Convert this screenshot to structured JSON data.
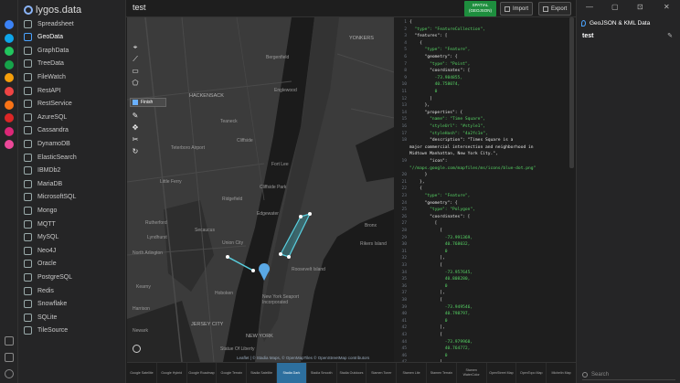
{
  "rail": {
    "icons": [
      {
        "name": "spreadsheet-rail-icon",
        "color": "#3b82f6"
      },
      {
        "name": "geodata-rail-icon",
        "color": "#0ea5e9"
      },
      {
        "name": "graphdata-rail-icon",
        "color": "#22c55e"
      },
      {
        "name": "treedata-rail-icon",
        "color": "#16a34a"
      },
      {
        "name": "filewatch-rail-icon",
        "color": "#f59e0b"
      },
      {
        "name": "restapi-rail-icon",
        "color": "#ef4444"
      },
      {
        "name": "restservice-rail-icon",
        "color": "#f97316"
      },
      {
        "name": "azuresql-rail-icon",
        "color": "#dc2626"
      },
      {
        "name": "cassandra-rail-icon",
        "color": "#db2777"
      },
      {
        "name": "dynamodb-rail-icon",
        "color": "#ec4899"
      }
    ]
  },
  "sidebar": {
    "brand": "lygos.data",
    "items": [
      {
        "label": "Spreadsheet",
        "icon": "grid-icon"
      },
      {
        "label": "GeoData",
        "icon": "globe-icon"
      },
      {
        "label": "GraphData",
        "icon": "graph-icon"
      },
      {
        "label": "TreeData",
        "icon": "tree-icon"
      },
      {
        "label": "FileWatch",
        "icon": "file-icon"
      },
      {
        "label": "RestAPI",
        "icon": "api-icon"
      },
      {
        "label": "RestService",
        "icon": "service-icon"
      },
      {
        "label": "AzureSQL",
        "icon": "database-icon"
      },
      {
        "label": "Cassandra",
        "icon": "database-icon"
      },
      {
        "label": "DynamoDB",
        "icon": "database-icon"
      },
      {
        "label": "ElasticSearch",
        "icon": "search-icon"
      },
      {
        "label": "IBMDb2",
        "icon": "database-icon"
      },
      {
        "label": "MariaDB",
        "icon": "database-icon"
      },
      {
        "label": "MicrosoftSQL",
        "icon": "database-icon"
      },
      {
        "label": "Mongo",
        "icon": "database-icon"
      },
      {
        "label": "MQTT",
        "icon": "broadcast-icon"
      },
      {
        "label": "MySQL",
        "icon": "database-icon"
      },
      {
        "label": "Neo4J",
        "icon": "graph-icon"
      },
      {
        "label": "Oracle",
        "icon": "database-icon"
      },
      {
        "label": "PostgreSQL",
        "icon": "database-icon"
      },
      {
        "label": "Redis",
        "icon": "database-icon"
      },
      {
        "label": "Snowflake",
        "icon": "snowflake-icon"
      },
      {
        "label": "SQLite",
        "icon": "database-icon"
      },
      {
        "label": "TileSource",
        "icon": "tiles-icon"
      }
    ],
    "active_index": 1
  },
  "topbar": {
    "title": "test",
    "badge": "SPATIAL (GEOJSON)",
    "import_label": "Import",
    "export_label": "Export"
  },
  "map": {
    "labels": {
      "yonkers": "YONKERS",
      "hackensack": "HACKENSACK",
      "englewood": "Englewood",
      "teaneck": "Teaneck",
      "bergenfield": "Bergenfield",
      "fort_lee": "Fort Lee",
      "cliffside_park": "Cliffside Park",
      "teterboro": "Teterboro Airport",
      "little_ferry": "Little Ferry",
      "ridgefield": "Ridgefield",
      "union_city": "Union City",
      "hoboken": "Hoboken",
      "jersey_city": "JERSEY CITY",
      "new_york": "NEW YORK",
      "ny_seaport": "New York Seaport Incorporated",
      "roosevelt_island": "Roosevelt Island",
      "bronx": "Bronx",
      "rikers": "Rikers Island",
      "north_arlington": "North Arlington",
      "kearny": "Kearny",
      "harrison": "Harrison",
      "newark": "Newark",
      "rutherford": "Rutherford",
      "lyndhurst": "Lyndhurst",
      "secaucus": "Secaucus",
      "cliffside": "Cliffside",
      "edgewater": "Edgewater",
      "statue": "Statue Of Liberty"
    },
    "finish_label": "Finish",
    "attribution": "Leaflet | © Stadia Maps, © OpenMapTiles © OpenStreetMap contributors"
  },
  "basemaps": [
    {
      "label": "Google Satellite"
    },
    {
      "label": "Google Hybrid"
    },
    {
      "label": "Google Roadmap"
    },
    {
      "label": "Google Terrain"
    },
    {
      "label": "Stadia Satellite"
    },
    {
      "label": "Stadia Dark"
    },
    {
      "label": "Stadia Smooth"
    },
    {
      "label": "Stadia Outdoors"
    },
    {
      "label": "Stamen Toner"
    },
    {
      "label": "Stamen Lite"
    },
    {
      "label": "Stamen Terrain"
    },
    {
      "label": "Stamen WaterColor"
    },
    {
      "label": "OpenStreet Map"
    },
    {
      "label": "OpenTopo Map"
    },
    {
      "label": "Michelin Map"
    }
  ],
  "basemap_active_index": 5,
  "code": {
    "lines": [
      {
        "n": "1",
        "t": "{"
      },
      {
        "n": "2",
        "t": "  \"type\": \"FeatureCollection\","
      },
      {
        "n": "3",
        "t": "  \"features\": ["
      },
      {
        "n": "4",
        "t": "    {"
      },
      {
        "n": "5",
        "t": "      \"type\": \"Feature\","
      },
      {
        "n": "6",
        "t": "      \"geometry\": {"
      },
      {
        "n": "7",
        "t": "        \"type\": \"Point\","
      },
      {
        "n": "8",
        "t": "        \"coordinates\": ["
      },
      {
        "n": "9",
        "t": "          -73.984855,"
      },
      {
        "n": "10",
        "t": "          40.758074,"
      },
      {
        "n": "11",
        "t": "          0"
      },
      {
        "n": "12",
        "t": "        ]"
      },
      {
        "n": "13",
        "t": "      },"
      },
      {
        "n": "14",
        "t": "      \"properties\": {"
      },
      {
        "n": "15",
        "t": "        \"name\": \"Time Square\","
      },
      {
        "n": "16",
        "t": "        \"styleUrl\": \"#style1\","
      },
      {
        "n": "17",
        "t": "        \"styleHash\": \"4a2fc1e\","
      },
      {
        "n": "18",
        "t": "        \"description\": \"Times Square is a"
      },
      {
        "n": "",
        "t": "major commercial intersection and neighborhood in"
      },
      {
        "n": "",
        "t": "Midtown Manhattan, New York City.\","
      },
      {
        "n": "19",
        "t": "        \"icon\":"
      },
      {
        "n": "",
        "t": "\"//maps.google.com/mapfiles/ms/icons/blue-dot.png\""
      },
      {
        "n": "20",
        "t": "      }"
      },
      {
        "n": "21",
        "t": "    },"
      },
      {
        "n": "22",
        "t": "    {"
      },
      {
        "n": "23",
        "t": "      \"type\": \"Feature\","
      },
      {
        "n": "24",
        "t": "      \"geometry\": {"
      },
      {
        "n": "25",
        "t": "        \"type\": \"Polygon\","
      },
      {
        "n": "26",
        "t": "        \"coordinates\": ["
      },
      {
        "n": "27",
        "t": "          ["
      },
      {
        "n": "28",
        "t": "            ["
      },
      {
        "n": "29",
        "t": "              -73.991369,"
      },
      {
        "n": "30",
        "t": "              40.768032,"
      },
      {
        "n": "31",
        "t": "              0"
      },
      {
        "n": "32",
        "t": "            ],"
      },
      {
        "n": "33",
        "t": "            ["
      },
      {
        "n": "34",
        "t": "              -73.957645,"
      },
      {
        "n": "35",
        "t": "              40.808280,"
      },
      {
        "n": "36",
        "t": "              0"
      },
      {
        "n": "37",
        "t": "            ],"
      },
      {
        "n": "38",
        "t": "            ["
      },
      {
        "n": "39",
        "t": "              -73.949546,"
      },
      {
        "n": "40",
        "t": "              40.798797,"
      },
      {
        "n": "41",
        "t": "              0"
      },
      {
        "n": "42",
        "t": "            ],"
      },
      {
        "n": "43",
        "t": "            ["
      },
      {
        "n": "44",
        "t": "              -73.979960,"
      },
      {
        "n": "45",
        "t": "              40.764772,"
      },
      {
        "n": "46",
        "t": "              0"
      },
      {
        "n": "47",
        "t": "            ],"
      }
    ]
  },
  "right_panel": {
    "title": "GeoJSON & KML Data",
    "item_name": "test",
    "search_placeholder": "Search"
  }
}
